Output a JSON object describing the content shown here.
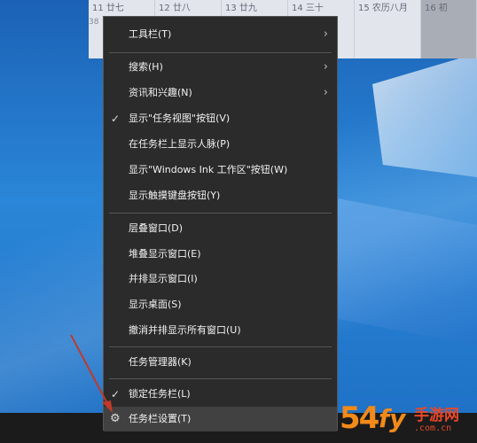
{
  "calendar": {
    "side_number": "38",
    "days": [
      {
        "label": "11 廿七"
      },
      {
        "label": "12 廿八"
      },
      {
        "label": "13 廿九"
      },
      {
        "label": "14 三十"
      },
      {
        "label": "15 农历八月"
      },
      {
        "label": "16 初"
      }
    ]
  },
  "context_menu": {
    "groups": [
      [
        {
          "label": "工具栏(T)",
          "has_submenu": true
        }
      ],
      [
        {
          "label": "搜索(H)",
          "has_submenu": true
        },
        {
          "label": "资讯和兴趣(N)",
          "has_submenu": true
        },
        {
          "label": "显示\"任务视图\"按钮(V)",
          "checked": true
        },
        {
          "label": "在任务栏上显示人脉(P)"
        },
        {
          "label": "显示\"Windows Ink 工作区\"按钮(W)"
        },
        {
          "label": "显示触摸键盘按钮(Y)"
        }
      ],
      [
        {
          "label": "层叠窗口(D)"
        },
        {
          "label": "堆叠显示窗口(E)"
        },
        {
          "label": "并排显示窗口(I)"
        },
        {
          "label": "显示桌面(S)"
        },
        {
          "label": "撤消并排显示所有窗口(U)"
        }
      ],
      [
        {
          "label": "任务管理器(K)"
        }
      ],
      [
        {
          "label": "锁定任务栏(L)",
          "checked": true
        },
        {
          "label": "任务栏设置(T)",
          "icon": "gear-icon",
          "highlighted": true
        }
      ]
    ]
  },
  "watermark": {
    "number": "54",
    "logo_mark": "fy",
    "name": "手游网",
    "url": ".com.cn"
  },
  "colors": {
    "menu_bg": "#2b2b2b",
    "menu_hover": "#414141",
    "arrow": "#c0392b",
    "watermark_orange": "#f28a1a",
    "watermark_red": "#e8482a"
  }
}
